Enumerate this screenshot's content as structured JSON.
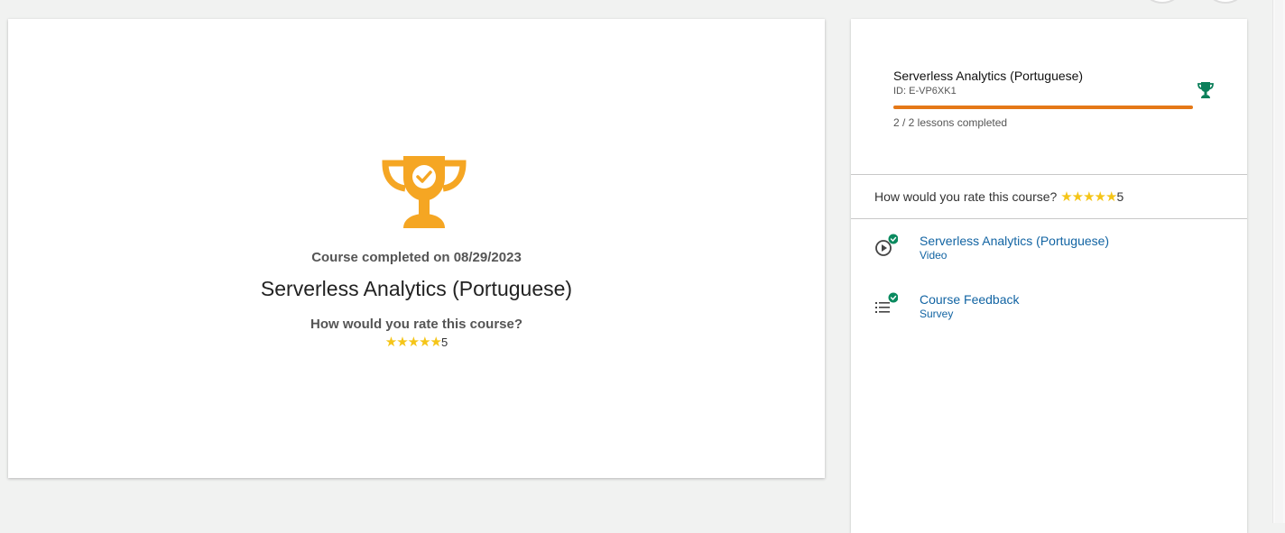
{
  "main": {
    "completed_text": "Course completed on 08/29/2023",
    "course_title": "Serverless Analytics (Portuguese)",
    "rate_question": "How would you rate this course?",
    "stars": "★★★★★",
    "rating": "5"
  },
  "side": {
    "title": "Serverless Analytics (Portuguese)",
    "course_id": "ID: E-VP6XK1",
    "progress_fraction": 1.0,
    "lessons_completed": "2 / 2 lessons completed",
    "rate_question": "How would you rate this course?",
    "stars": "★★★★★",
    "rating": "5",
    "items": [
      {
        "title": "Serverless Analytics (Portuguese)",
        "type": "Video",
        "icon": "play-circle-icon",
        "completed": true
      },
      {
        "title": "Course Feedback",
        "type": "Survey",
        "icon": "list-icon",
        "completed": true
      }
    ]
  },
  "colors": {
    "trophy_main": "#f5a623",
    "trophy_small": "#0a7f5a",
    "progress": "#e57817",
    "link": "#1264a3",
    "check": "#0a8a5f",
    "star": "#f5c518"
  }
}
